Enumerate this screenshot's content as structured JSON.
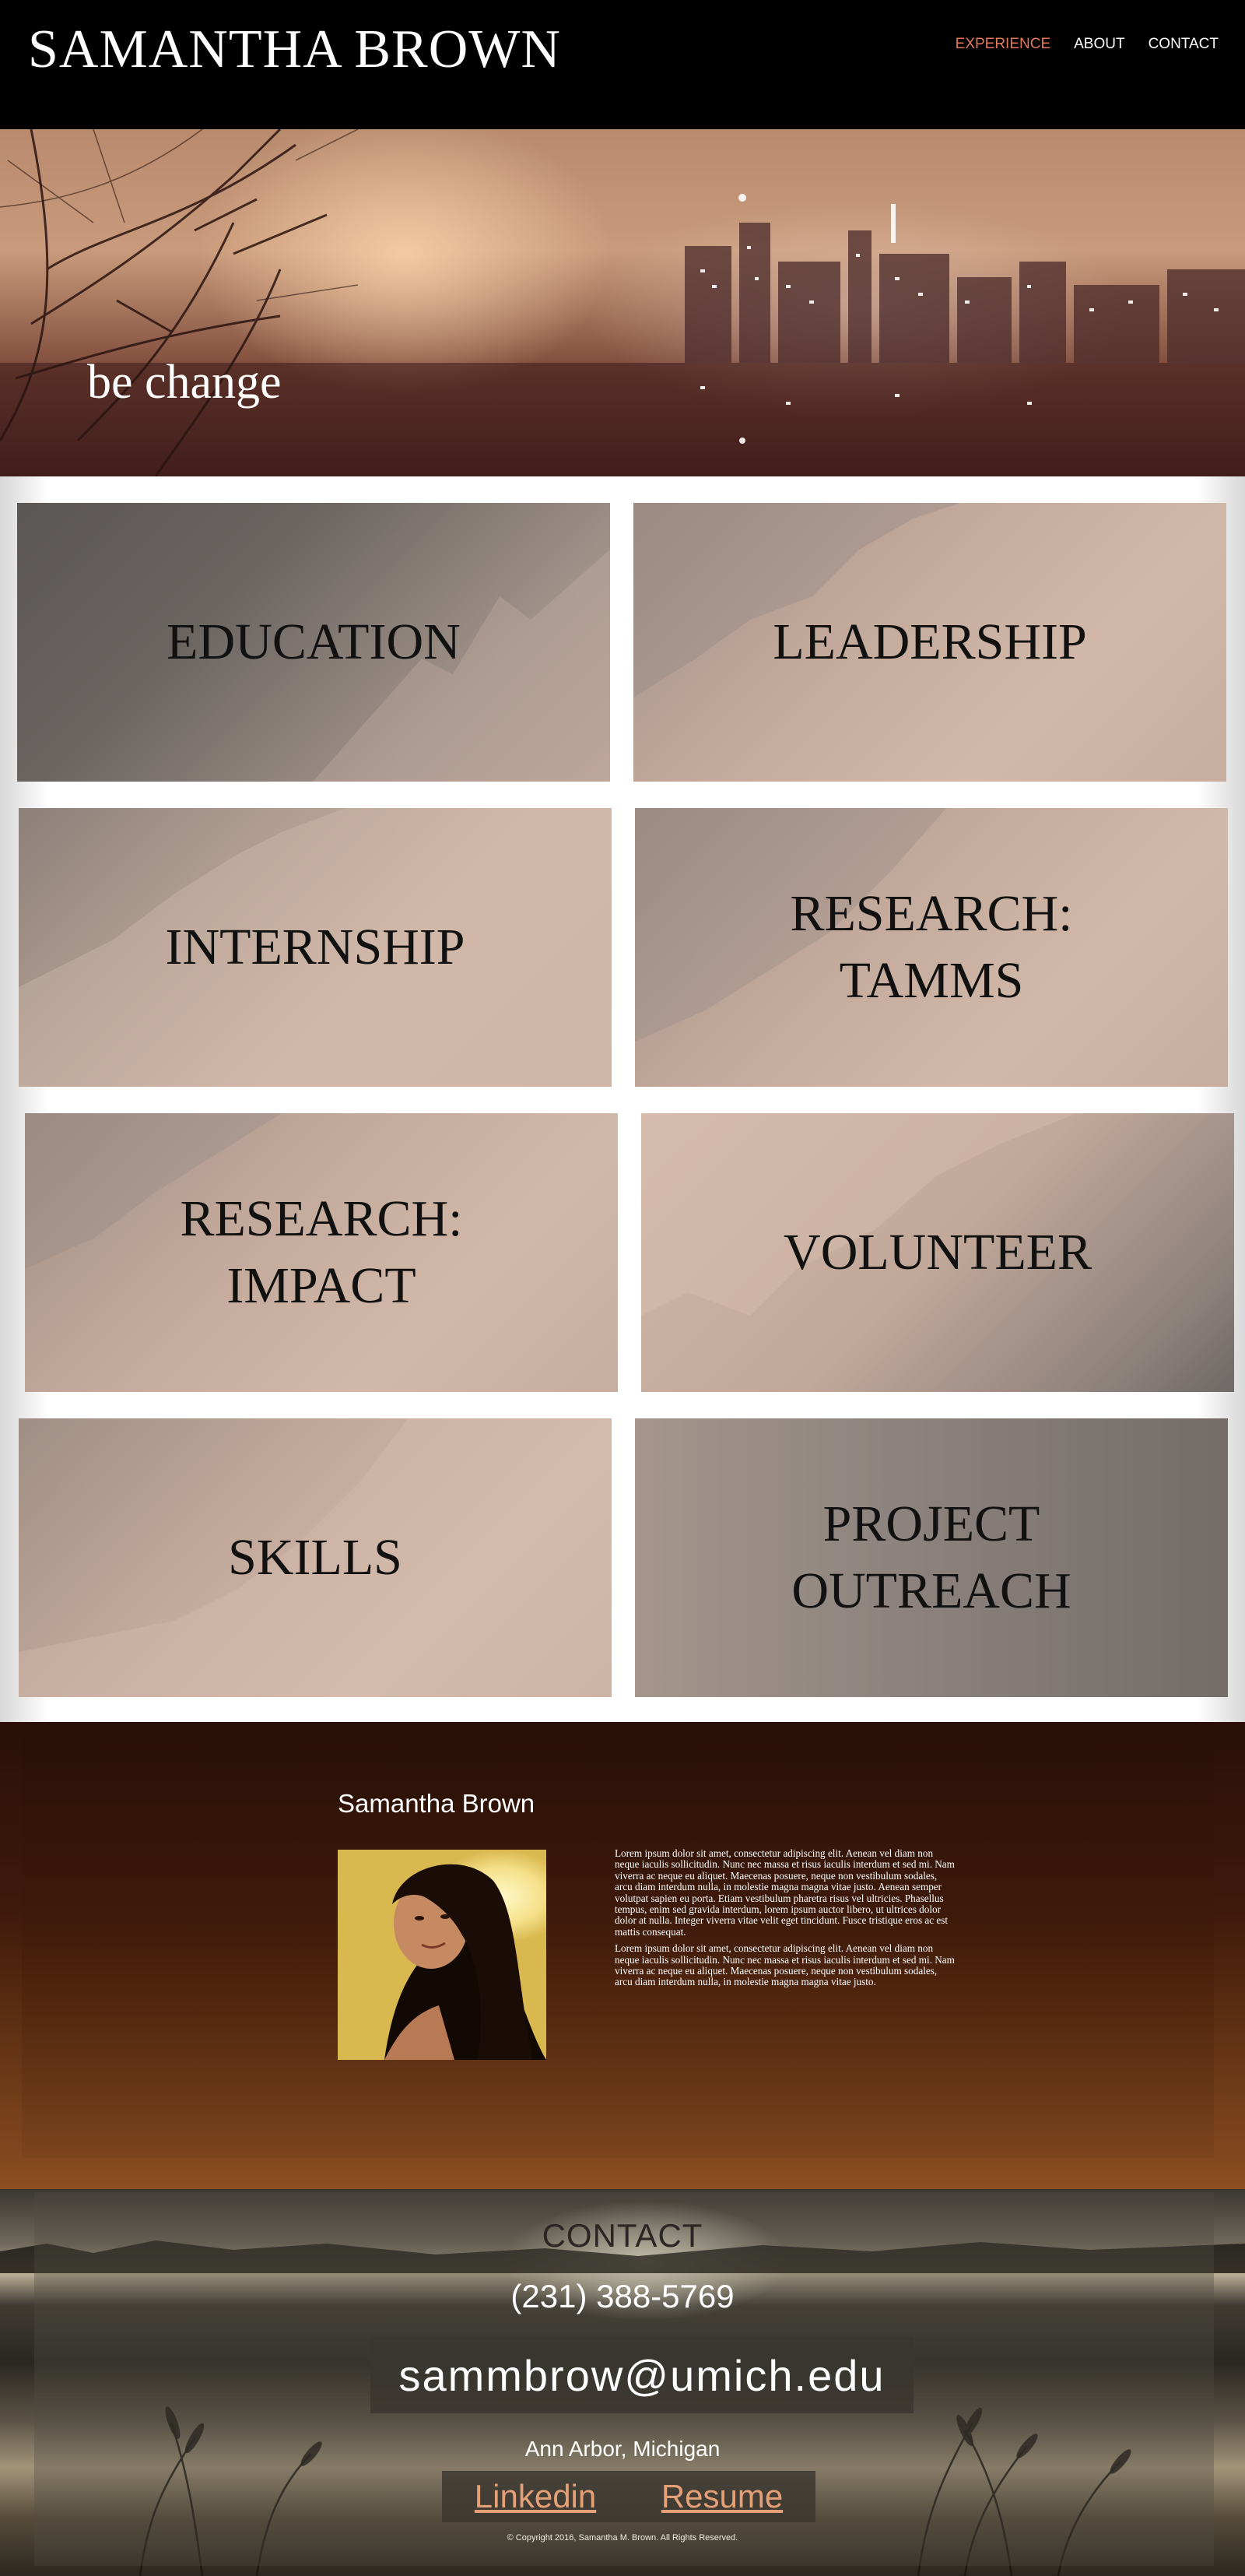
{
  "header": {
    "title": "SAMANTHA BROWN",
    "nav": [
      {
        "label": "EXPERIENCE",
        "active": true
      },
      {
        "label": "ABOUT",
        "active": false
      },
      {
        "label": "CONTACT",
        "active": false
      }
    ],
    "accent_color": "#e3785a"
  },
  "hero": {
    "tagline": "be change"
  },
  "tiles": [
    {
      "label": "EDUCATION"
    },
    {
      "label": "LEADERSHIP"
    },
    {
      "label": "INTERNSHIP"
    },
    {
      "label": "RESEARCH:\nTAMMS"
    },
    {
      "label": "RESEARCH:\nIMPACT"
    },
    {
      "label": "VOLUNTEER"
    },
    {
      "label": "SKILLS"
    },
    {
      "label": "PROJECT\nOUTREACH"
    }
  ],
  "about": {
    "name": "Samantha Brown",
    "bio": [
      "Lorem ipsum dolor sit amet, consectetur adipiscing elit. Aenean vel diam non neque iaculis sollicitudin. Nunc nec massa et risus iaculis interdum et sed mi. Nam viverra ac neque eu aliquet. Maecenas posuere, neque non vestibulum sodales, arcu diam interdum nulla, in molestie magna magna vitae justo. Aenean semper volutpat sapien eu porta. Etiam vestibulum pharetra risus vel ultricies. Phasellus tempus, enim sed gravida interdum, lorem ipsum auctor libero, ut ultrices dolor dolor at nulla. Integer viverra vitae velit eget tincidunt. Fusce tristique eros ac est mattis consequat.",
      "Lorem ipsum dolor sit amet, consectetur adipiscing elit. Aenean vel diam non neque iaculis sollicitudin. Nunc nec massa et risus iaculis interdum et sed mi. Nam viverra ac neque eu aliquet. Maecenas posuere, neque non vestibulum sodales, arcu diam interdum nulla, in molestie magna magna vitae justo."
    ]
  },
  "contact": {
    "title": "CONTACT",
    "phone": "(231) 388-5769",
    "email": "sammbrow@umich.edu",
    "city": "Ann Arbor, Michigan",
    "links": [
      {
        "label": "Linkedin"
      },
      {
        "label": "Resume"
      }
    ],
    "link_color": "#e6a078",
    "copyright": "© Copyright 2016, Samantha M. Brown. All Rights Reserved."
  }
}
